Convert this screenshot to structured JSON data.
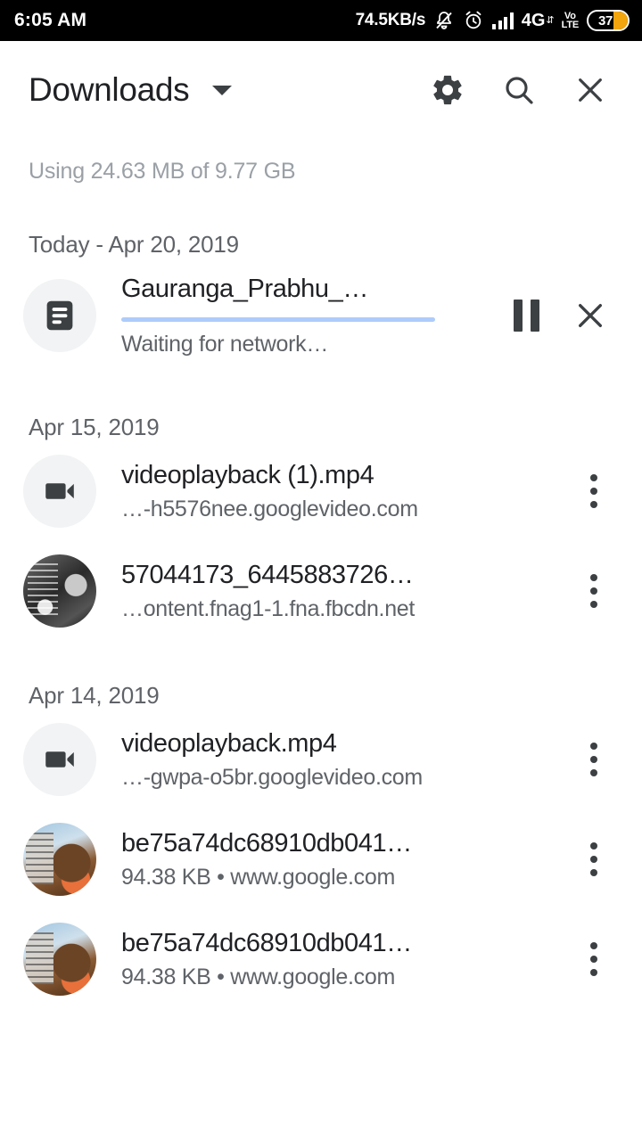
{
  "statusbar": {
    "time": "6:05 AM",
    "network_speed": "74.5KB/s",
    "icons": [
      "bell-muted-icon",
      "alarm-clock-icon",
      "signal-bars-icon"
    ],
    "network_type": "4G",
    "data_arrows": "⇵",
    "volte_top": "Vo))",
    "volte_line1": "Vo",
    "volte_line2": "LTE",
    "battery_percent": "37",
    "battery_color": "#f2a50c"
  },
  "toolbar": {
    "title": "Downloads",
    "caret_icon": "chevron-down-icon",
    "settings_icon": "gear-icon",
    "search_icon": "search-icon",
    "close_icon": "close-icon"
  },
  "storage": {
    "text": "Using 24.63 MB of 9.77 GB"
  },
  "sections": [
    {
      "date_label": "Today - Apr 20, 2019",
      "items": [
        {
          "type": "active-download",
          "icon": "document-icon",
          "title": "Gauranga_Prabhu_…",
          "status": "Waiting for network…",
          "progress_color": "#aecbfa",
          "pause_label": "pause-icon",
          "cancel_label": "close-icon"
        }
      ]
    },
    {
      "date_label": "Apr 15, 2019",
      "items": [
        {
          "type": "file",
          "icon": "video-camera-icon",
          "title": "videoplayback (1).mp4",
          "subtitle": "…-h5576nee.googlevideo.com"
        },
        {
          "type": "file",
          "icon": "photo-thumbnail-bw",
          "title": "57044173_6445883726…",
          "subtitle": "…ontent.fnag1-1.fna.fbcdn.net"
        }
      ]
    },
    {
      "date_label": "Apr 14, 2019",
      "items": [
        {
          "type": "file",
          "icon": "video-camera-icon",
          "title": "videoplayback.mp4",
          "subtitle": "…-gwpa-o5br.googlevideo.com"
        },
        {
          "type": "file",
          "icon": "photo-thumbnail-color",
          "title": "be75a74dc68910db041…",
          "subtitle": "94.38 KB • www.google.com"
        },
        {
          "type": "file",
          "icon": "photo-thumbnail-color",
          "title": "be75a74dc68910db041…",
          "subtitle": "94.38 KB • www.google.com"
        }
      ]
    }
  ],
  "colors": {
    "accent": "#aecbfa",
    "title_text": "#202124",
    "secondary_text": "#5f6368",
    "muted_text": "#9aa0a6",
    "icon_bg": "#f1f3f4",
    "background": "#ffffff"
  }
}
